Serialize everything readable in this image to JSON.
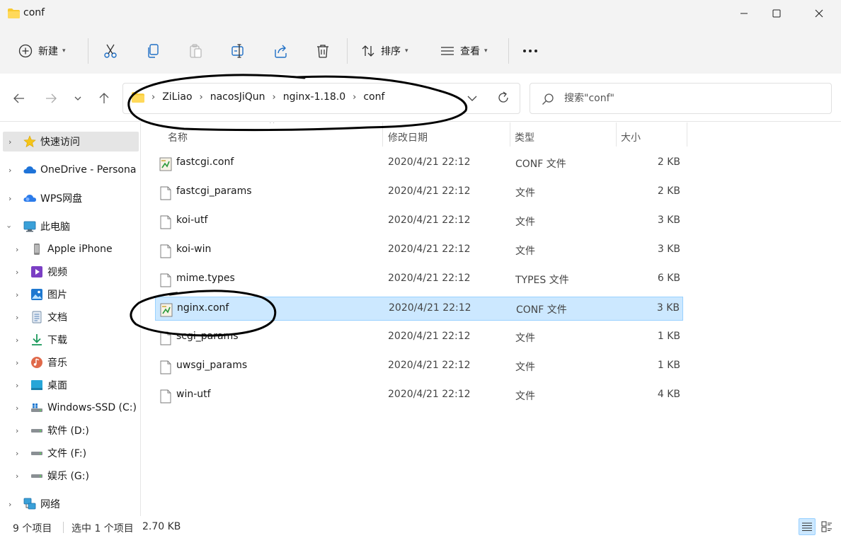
{
  "window": {
    "title": "conf",
    "minimize_icon": "minimize-icon",
    "maximize_icon": "maximize-icon",
    "close_icon": "close-icon"
  },
  "toolbar": {
    "new_label": "新建",
    "sort_label": "排序",
    "view_label": "查看",
    "icons": [
      "plus-circle-icon",
      "scissors-icon",
      "copy-icon",
      "paste-icon",
      "rename-icon",
      "share-icon",
      "trash-icon",
      "sort-icon",
      "view-icon",
      "more-icon"
    ]
  },
  "nav": {
    "breadcrumbs": [
      "ZiLiao",
      "nacosJiQun",
      "nginx-1.18.0",
      "conf"
    ],
    "search_placeholder": "搜索\"conf\""
  },
  "sidebar": {
    "items": [
      {
        "label": "快速访问",
        "icon": "star-icon"
      },
      {
        "label": "OneDrive - Persona",
        "icon": "cloud-icon"
      },
      {
        "label": "WPS网盘",
        "icon": "wps-cloud-icon"
      },
      {
        "label": "此电脑",
        "icon": "computer-icon"
      },
      {
        "label": "Apple iPhone",
        "icon": "phone-icon"
      },
      {
        "label": "视频",
        "icon": "video-icon"
      },
      {
        "label": "图片",
        "icon": "pictures-icon"
      },
      {
        "label": "文档",
        "icon": "documents-icon"
      },
      {
        "label": "下载",
        "icon": "download-icon"
      },
      {
        "label": "音乐",
        "icon": "music-icon"
      },
      {
        "label": "桌面",
        "icon": "desktop-icon"
      },
      {
        "label": "Windows-SSD (C:)",
        "icon": "windows-drive-icon"
      },
      {
        "label": "软件 (D:)",
        "icon": "drive-icon"
      },
      {
        "label": "文件 (F:)",
        "icon": "drive-icon"
      },
      {
        "label": "娱乐 (G:)",
        "icon": "drive-icon"
      },
      {
        "label": "网络",
        "icon": "network-icon"
      }
    ]
  },
  "columns": {
    "name": "名称",
    "date": "修改日期",
    "type": "类型",
    "size": "大小"
  },
  "files": [
    {
      "name": "fastcgi.conf",
      "date": "2020/4/21 22:12",
      "type": "CONF 文件",
      "size": "2 KB",
      "icon": "conf-file-icon"
    },
    {
      "name": "fastcgi_params",
      "date": "2020/4/21 22:12",
      "type": "文件",
      "size": "2 KB",
      "icon": "file-icon"
    },
    {
      "name": "koi-utf",
      "date": "2020/4/21 22:12",
      "type": "文件",
      "size": "3 KB",
      "icon": "file-icon"
    },
    {
      "name": "koi-win",
      "date": "2020/4/21 22:12",
      "type": "文件",
      "size": "3 KB",
      "icon": "file-icon"
    },
    {
      "name": "mime.types",
      "date": "2020/4/21 22:12",
      "type": "TYPES 文件",
      "size": "6 KB",
      "icon": "file-icon"
    },
    {
      "name": "nginx.conf",
      "date": "2020/4/21 22:12",
      "type": "CONF 文件",
      "size": "3 KB",
      "icon": "conf-file-icon",
      "selected": true
    },
    {
      "name": "scgi_params",
      "date": "2020/4/21 22:12",
      "type": "文件",
      "size": "1 KB",
      "icon": "file-icon"
    },
    {
      "name": "uwsgi_params",
      "date": "2020/4/21 22:12",
      "type": "文件",
      "size": "1 KB",
      "icon": "file-icon"
    },
    {
      "name": "win-utf",
      "date": "2020/4/21 22:12",
      "type": "文件",
      "size": "4 KB",
      "icon": "file-icon"
    }
  ],
  "status": {
    "count": "9 个项目",
    "selection": "选中 1 个项目",
    "selection_size": "2.70 KB"
  },
  "colors": {
    "selection_bg": "#cce8ff",
    "selection_border": "#99d1ff",
    "folder_yellow": "#f8c92f",
    "annotation_ink": "#000000"
  }
}
